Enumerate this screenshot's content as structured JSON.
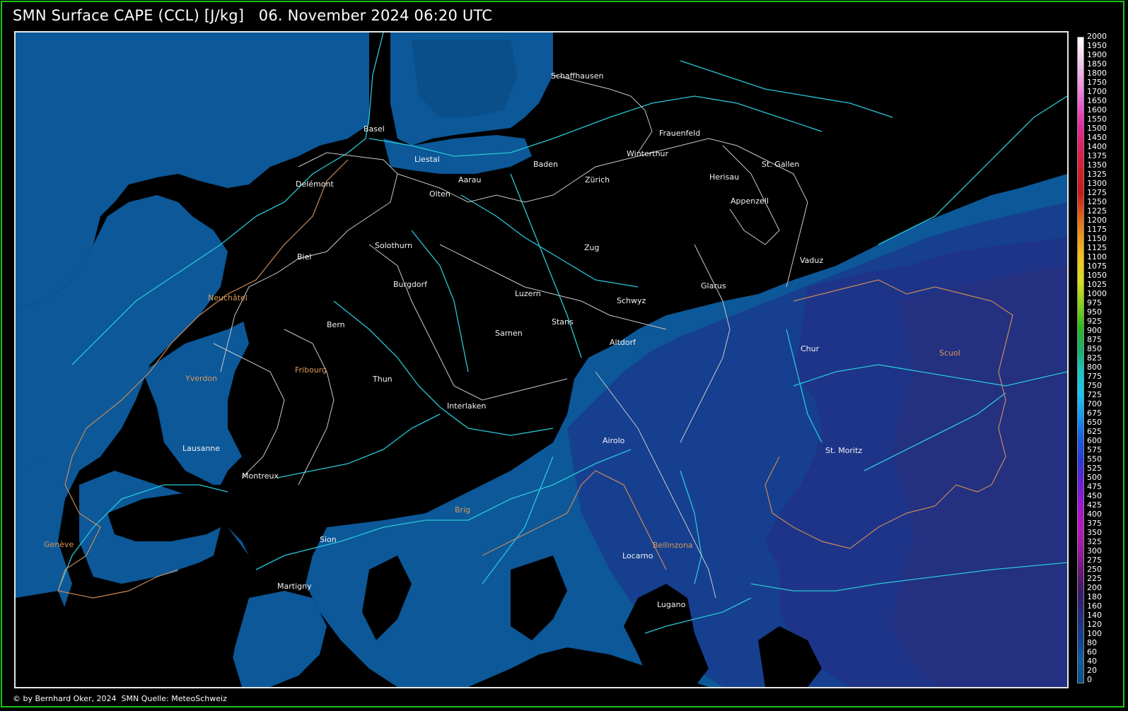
{
  "header": {
    "title": "SMN Surface CAPE (CCL) [J/kg]   06. November 2024 06:20 UTC"
  },
  "footer": {
    "credit": "© by Bernhard Oker, 2024  SMN Quelle: MeteoSchweiz"
  },
  "colors": {
    "frame": "#19c419",
    "background": "#000000",
    "cape_0": "#0a4f8a",
    "cape_20": "#10609e",
    "cape_40": "#1a3f8f",
    "cape_60": "#232f83",
    "rivers": "#28c8d8",
    "borders": "#c9c9c9",
    "country_border": "#c88a5a"
  },
  "cities": [
    {
      "name": "Schaffhausen",
      "color": "wh"
    },
    {
      "name": "Frauenfeld",
      "color": "wh"
    },
    {
      "name": "Basel",
      "color": "wh"
    },
    {
      "name": "Liestal",
      "color": "wh"
    },
    {
      "name": "Baden",
      "color": "wh"
    },
    {
      "name": "Winterthur",
      "color": "wh"
    },
    {
      "name": "Aarau",
      "color": "wh"
    },
    {
      "name": "Zürich",
      "color": "wh"
    },
    {
      "name": "Herisau",
      "color": "wh"
    },
    {
      "name": "St. Gallen",
      "color": "wh"
    },
    {
      "name": "Delémont",
      "color": "wh"
    },
    {
      "name": "Olten",
      "color": "wh"
    },
    {
      "name": "Appenzell",
      "color": "wh"
    },
    {
      "name": "Solothurn",
      "color": "wh"
    },
    {
      "name": "Zug",
      "color": "wh"
    },
    {
      "name": "Biel",
      "color": "wh"
    },
    {
      "name": "Vaduz",
      "color": "wh"
    },
    {
      "name": "Burgdorf",
      "color": "wh"
    },
    {
      "name": "Glarus",
      "color": "wh"
    },
    {
      "name": "Luzern",
      "color": "wh"
    },
    {
      "name": "Neuchâtel",
      "color": "or"
    },
    {
      "name": "Schwyz",
      "color": "wh"
    },
    {
      "name": "Bern",
      "color": "wh"
    },
    {
      "name": "Stans",
      "color": "wh"
    },
    {
      "name": "Sarnen",
      "color": "wh"
    },
    {
      "name": "Altdorf",
      "color": "wh"
    },
    {
      "name": "Chur",
      "color": "wh"
    },
    {
      "name": "Scuol",
      "color": "or"
    },
    {
      "name": "Fribourg",
      "color": "or"
    },
    {
      "name": "Thun",
      "color": "wh"
    },
    {
      "name": "Yverdon",
      "color": "or"
    },
    {
      "name": "Interlaken",
      "color": "wh"
    },
    {
      "name": "Airolo",
      "color": "wh"
    },
    {
      "name": "Lausanne",
      "color": "wh"
    },
    {
      "name": "St. Moritz",
      "color": "wh"
    },
    {
      "name": "Montreux",
      "color": "wh"
    },
    {
      "name": "Brig",
      "color": "or"
    },
    {
      "name": "Genève",
      "color": "or"
    },
    {
      "name": "Sion",
      "color": "wh"
    },
    {
      "name": "Bellinzona",
      "color": "or"
    },
    {
      "name": "Locarno",
      "color": "wh"
    },
    {
      "name": "Martigny",
      "color": "wh"
    },
    {
      "name": "Lugano",
      "color": "wh"
    }
  ],
  "legend": {
    "ticks": [
      "2000",
      "1950",
      "1900",
      "1850",
      "1800",
      "1750",
      "1700",
      "1650",
      "1600",
      "1550",
      "1500",
      "1450",
      "1400",
      "1375",
      "1350",
      "1325",
      "1300",
      "1275",
      "1250",
      "1225",
      "1200",
      "1175",
      "1150",
      "1125",
      "1100",
      "1075",
      "1050",
      "1025",
      "1000",
      "975",
      "950",
      "925",
      "900",
      "875",
      "850",
      "825",
      "800",
      "775",
      "750",
      "725",
      "700",
      "675",
      "650",
      "625",
      "600",
      "575",
      "550",
      "525",
      "500",
      "475",
      "450",
      "425",
      "400",
      "375",
      "350",
      "325",
      "300",
      "275",
      "250",
      "225",
      "200",
      "180",
      "160",
      "140",
      "120",
      "100",
      "80",
      "60",
      "40",
      "20",
      "0"
    ],
    "gradient": [
      "#ffffff",
      "#f4d0f0",
      "#ee9ee0",
      "#ea5fcf",
      "#e52a9c",
      "#e0205a",
      "#d61e2a",
      "#c8191e",
      "#e0601a",
      "#ee9a18",
      "#f2c81a",
      "#d6e01a",
      "#8cd21a",
      "#30b81e",
      "#18b06a",
      "#18c8c0",
      "#18c8f0",
      "#1898f0",
      "#1860e0",
      "#2a38d8",
      "#6a20d8",
      "#9a18d0",
      "#b818c0",
      "#9a1ca0",
      "#6a1a78",
      "#3a1a6a",
      "#243080",
      "#173f8f",
      "#10609e",
      "#0a4f8a"
    ]
  }
}
